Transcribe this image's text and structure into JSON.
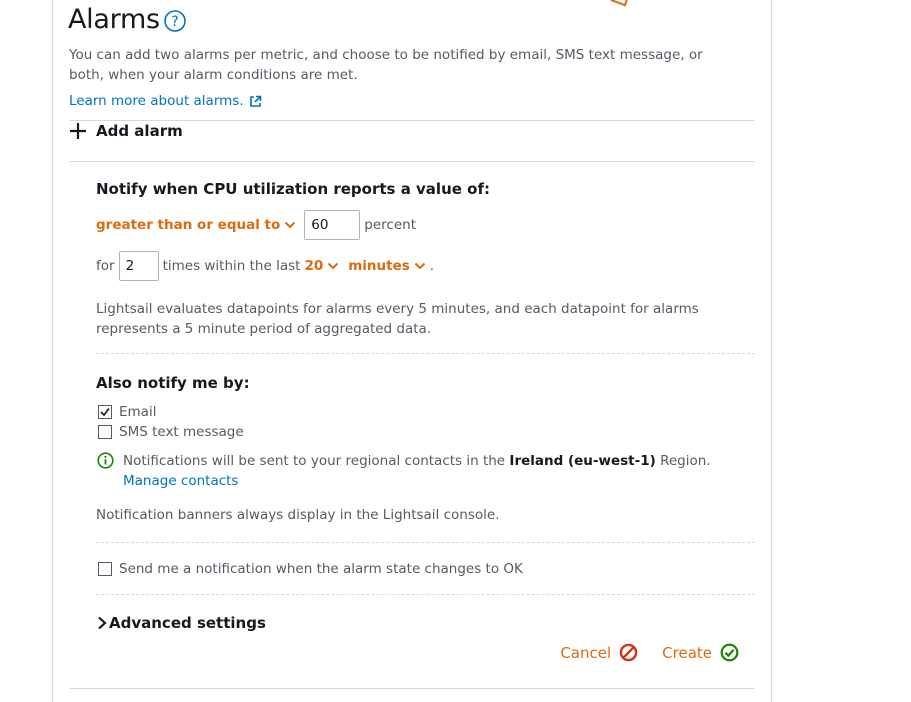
{
  "section": {
    "title": "Alarms",
    "description": "You can add two alarms per metric, and choose to be notified by email, SMS text message, or both, when your alarm conditions are met.",
    "learn_more": "Learn more about alarms.",
    "add_alarm": "Add alarm"
  },
  "alarm": {
    "heading": "Notify when CPU utilization reports a value of:",
    "operator": "greater than or equal to",
    "threshold": "60",
    "unit": "percent",
    "for_label": "for",
    "times": "2",
    "times_label": "times within the last",
    "period_value": "20",
    "period_unit": "minutes",
    "period_end": ".",
    "evaluation_note": "Lightsail evaluates datapoints for alarms every 5 minutes, and each datapoint for alarms represents a 5 minute period of aggregated data."
  },
  "notify": {
    "heading": "Also notify me by:",
    "options": [
      {
        "label": "Email",
        "checked": true
      },
      {
        "label": "SMS text message",
        "checked": false
      }
    ],
    "info_prefix": "Notifications will be sent to your regional contacts in the",
    "region": "Ireland (eu-west-1)",
    "info_suffix": "Region.",
    "manage_contacts": "Manage contacts",
    "banner_note": "Notification banners always display in the Lightsail console.",
    "ok_state": {
      "label": "Send me a notification when the alarm state changes to OK",
      "checked": false
    }
  },
  "advanced": {
    "label": "Advanced settings"
  },
  "actions": {
    "cancel": "Cancel",
    "create": "Create"
  },
  "colors": {
    "accent": "#dd6b10",
    "link": "#0073bb",
    "success": "#1d8102"
  }
}
